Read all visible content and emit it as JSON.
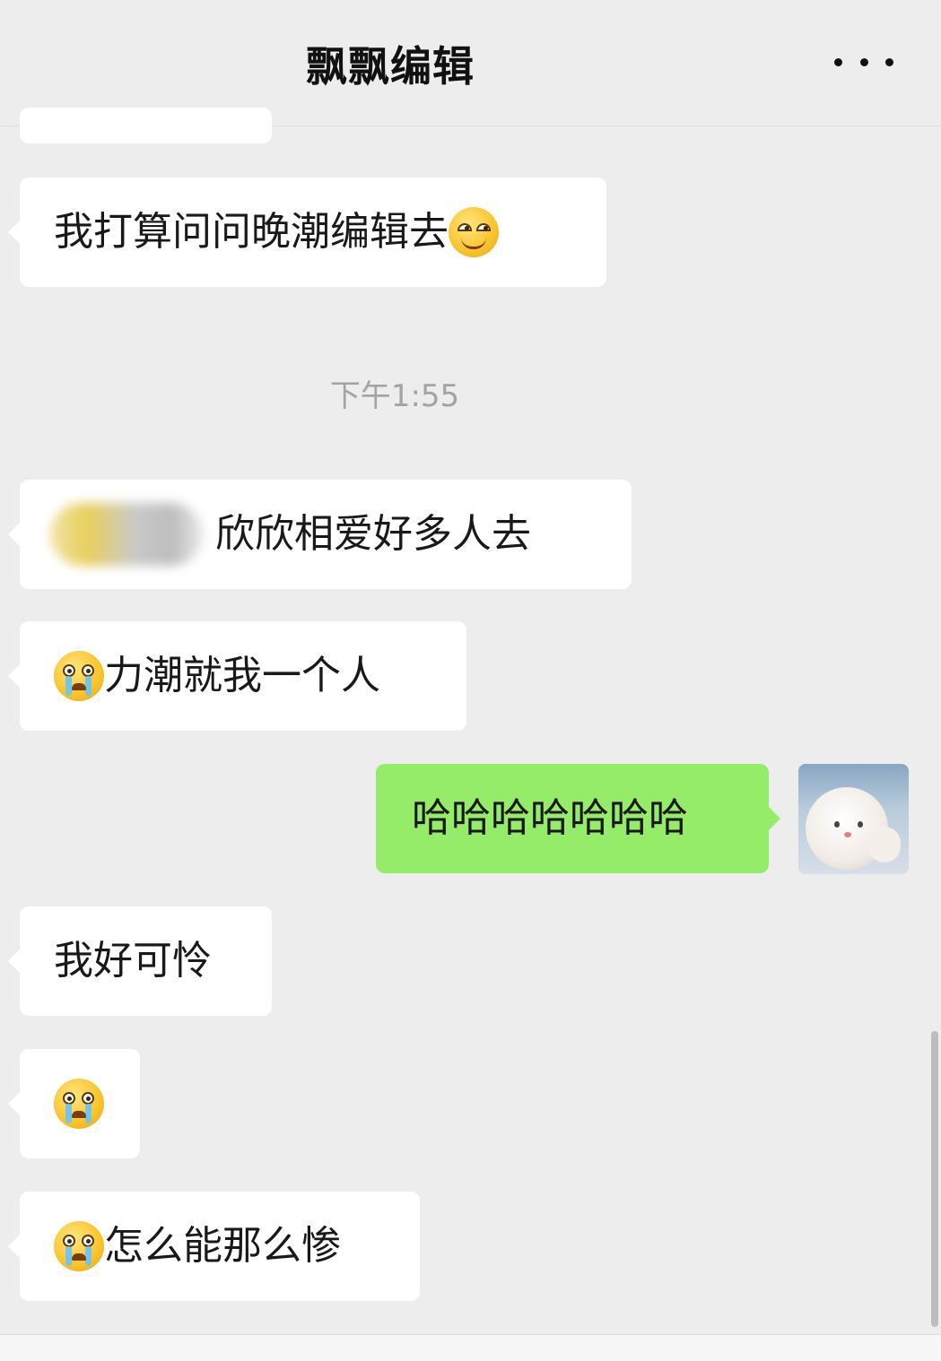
{
  "header": {
    "title": "飘飘编辑",
    "more_icon": "more-dots-icon"
  },
  "messages": [
    {
      "side": "left",
      "text": "我打算问问晚潮编辑去",
      "emoji": "smirk-emoji"
    },
    {
      "side": "left",
      "text": "欣欣相爱好多人去",
      "has_blurred_name": true
    },
    {
      "side": "left",
      "text": "力潮就我一个人",
      "emoji": "crying-emoji"
    },
    {
      "side": "right",
      "text": "哈哈哈哈哈哈哈"
    },
    {
      "side": "left",
      "text": "我好可怜"
    },
    {
      "side": "left",
      "text": "",
      "emoji": "crying-emoji"
    },
    {
      "side": "left",
      "text": "怎么能那么惨",
      "emoji": "crying-emoji"
    }
  ],
  "timestamp": "下午1:55",
  "colors": {
    "background": "#ededed",
    "incoming_bubble": "#ffffff",
    "outgoing_bubble": "#95ec69",
    "timestamp": "#a3a3a3"
  }
}
